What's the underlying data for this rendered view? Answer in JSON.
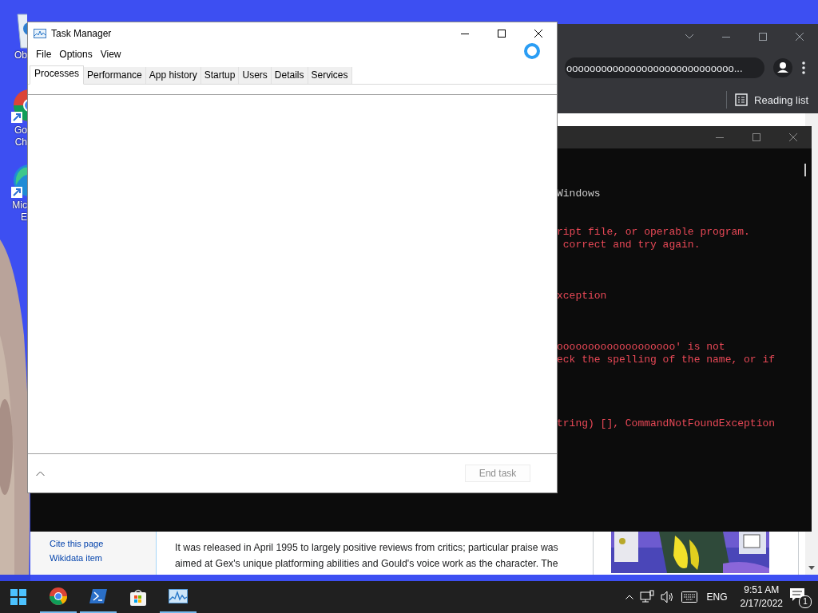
{
  "desktop": {
    "icons": [
      {
        "kind": "recycle",
        "label": [
          "Ob"
        ]
      },
      {
        "kind": "chrome",
        "label": [
          "Go",
          "Ch"
        ]
      },
      {
        "kind": "edge",
        "label": [
          "Mic",
          "E"
        ]
      }
    ]
  },
  "browser": {
    "address": "ooooooooooooooooooooooooooooo...",
    "bookmarks": [
      {
        "label": "Reading list"
      }
    ],
    "page": {
      "sidebar_links": [
        "Cite this page",
        "Wikidata item"
      ],
      "paragraph": [
        "It was released in April 1995 to largely positive reviews from critics; particular praise was",
        "aimed at Gex's unique platforming abilities and Gould's voice work as the character. The"
      ],
      "infobox_image": {
        "kind": "picture"
      }
    }
  },
  "terminal": {
    "lines": [
      {
        "kind": "output",
        "text": "Windows"
      },
      {
        "kind": "blank"
      },
      {
        "kind": "blank"
      },
      {
        "kind": "error",
        "text": "ript file, or operable program."
      },
      {
        "kind": "error",
        "text": " correct and try again."
      },
      {
        "kind": "blank"
      },
      {
        "kind": "blank"
      },
      {
        "kind": "blank"
      },
      {
        "kind": "error",
        "text": "xception"
      },
      {
        "kind": "blank"
      },
      {
        "kind": "blank"
      },
      {
        "kind": "blank"
      },
      {
        "kind": "error",
        "text": "ooooooooooooooooooo' is not"
      },
      {
        "kind": "error",
        "text": "eck the spelling of the name, or if"
      },
      {
        "kind": "blank"
      },
      {
        "kind": "blank"
      },
      {
        "kind": "blank"
      },
      {
        "kind": "blank"
      },
      {
        "kind": "error",
        "text": "tring) [], CommandNotFoundException"
      }
    ]
  },
  "task_manager": {
    "title": "Task Manager",
    "loading": true,
    "menu": [
      "File",
      "Options",
      "View"
    ],
    "tabs": [
      {
        "label": "Processes",
        "selected": true
      },
      {
        "label": "Performance",
        "selected": false
      },
      {
        "label": "App history",
        "selected": false
      },
      {
        "label": "Startup",
        "selected": false
      },
      {
        "label": "Users",
        "selected": false
      },
      {
        "label": "Details",
        "selected": false
      },
      {
        "label": "Services",
        "selected": false
      }
    ],
    "end_task": {
      "label": "End task",
      "disabled": true
    }
  },
  "taskbar": {
    "apps": [
      {
        "kind": "start",
        "running": false
      },
      {
        "kind": "chrome",
        "running": true
      },
      {
        "kind": "powershell",
        "running": true
      },
      {
        "kind": "store",
        "running": false
      },
      {
        "kind": "taskmanager",
        "running": true
      }
    ],
    "tray": {
      "language": "ENG",
      "time": "9:51 AM",
      "date": "2/17/2022",
      "notifications": "1"
    }
  }
}
